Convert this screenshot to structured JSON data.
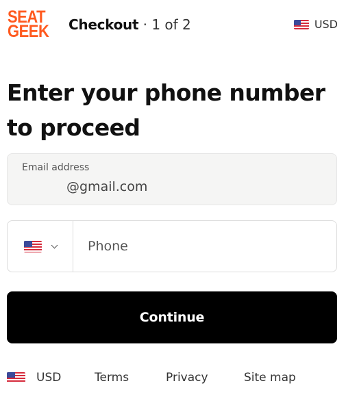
{
  "header": {
    "logo_line1": "SEAT",
    "logo_line2": "GEEK",
    "title": "Checkout",
    "step": " · 1 of 2",
    "currency": "USD"
  },
  "main": {
    "heading": "Enter your phone number to proceed",
    "email": {
      "label": "Email address",
      "value": "@gmail.com"
    },
    "phone": {
      "placeholder": "Phone",
      "country_flag": "us-flag-icon"
    },
    "continue_label": "Continue"
  },
  "footer": {
    "currency": "USD",
    "terms": "Terms",
    "privacy": "Privacy",
    "sitemap": "Site map"
  },
  "colors": {
    "brand": "#ff5a1f",
    "button_bg": "#000000",
    "field_bg": "#f5f5f4"
  }
}
